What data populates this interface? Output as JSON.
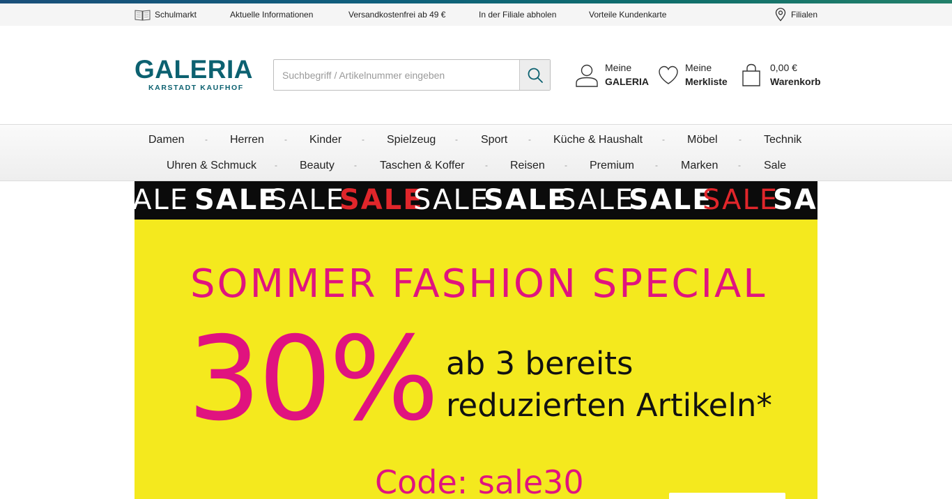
{
  "utility_bar": {
    "items": [
      {
        "label": "Schulmarkt",
        "icon": "book-icon"
      },
      {
        "label": "Aktuelle Informationen"
      },
      {
        "label": "Versandkostenfrei ab 49 €"
      },
      {
        "label": "In der Filiale abholen"
      },
      {
        "label": "Vorteile Kundenkarte"
      }
    ],
    "stores": {
      "label": "Filialen",
      "icon": "location-pin-icon"
    }
  },
  "header": {
    "logo": {
      "main": "GALERIA",
      "sub": "KARSTADT KAUFHOF"
    },
    "search": {
      "placeholder": "Suchbegriff / Artikelnummer eingeben",
      "value": "",
      "icon": "search-icon"
    },
    "account": {
      "line1": "Meine",
      "line2": "GALERIA",
      "icon": "user-icon"
    },
    "wishlist": {
      "line1": "Meine",
      "line2": "Merkliste",
      "icon": "heart-icon"
    },
    "cart": {
      "line1": "0,00 €",
      "line2": "Warenkorb",
      "icon": "shopping-bag-icon"
    }
  },
  "nav": {
    "row1": [
      "Damen",
      "Herren",
      "Kinder",
      "Spielzeug",
      "Sport",
      "Küche & Haushalt",
      "Möbel",
      "Technik"
    ],
    "row2": [
      "Uhren & Schmuck",
      "Beauty",
      "Taschen & Koffer",
      "Reisen",
      "Premium",
      "Marken",
      "Sale"
    ],
    "separator": "-"
  },
  "sale_banner": {
    "words": [
      "SALE",
      "SALE",
      "SALE",
      "SALE",
      "SALE",
      "SALE",
      "SALE",
      "SALE",
      "SALE",
      "SALE"
    ]
  },
  "promo": {
    "title": "SOMMER FASHION SPECIAL",
    "percent": "30%",
    "line1": "ab 3 bereits",
    "line2": "reduzierten Artikeln*",
    "code": "Code: sale30"
  },
  "colors": {
    "brand": "#0c6170",
    "promo_bg": "#f4e91e",
    "promo_pink": "#e0137f",
    "sale_red": "#e0262b",
    "sale_band_bg": "#0b0b0b"
  }
}
